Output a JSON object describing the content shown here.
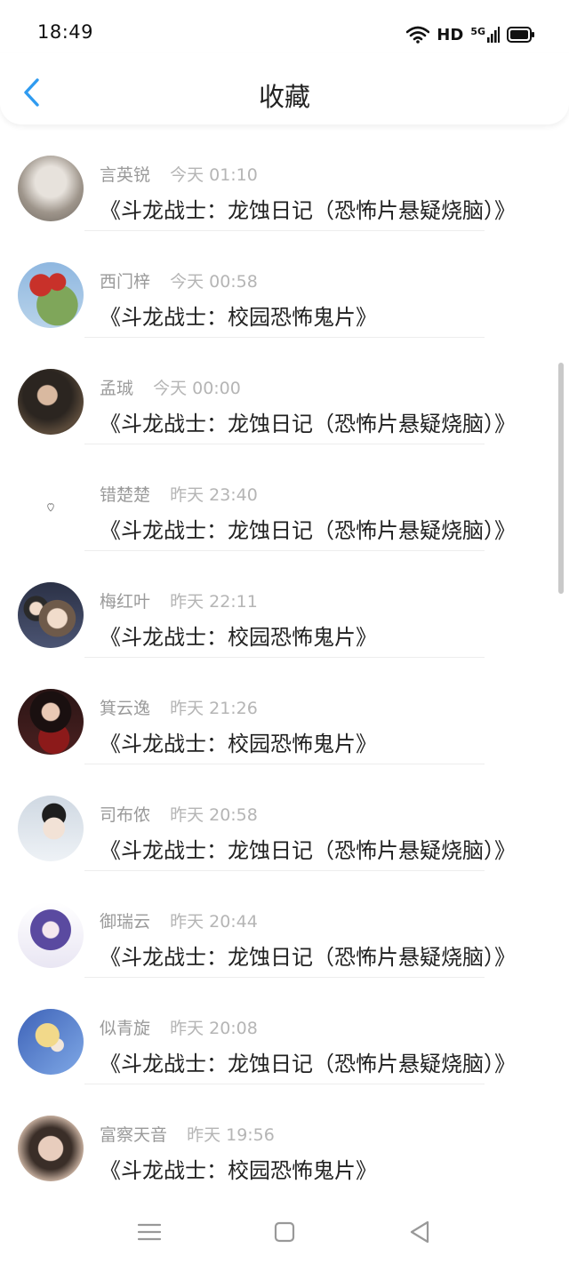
{
  "status": {
    "time": "18:49",
    "hd": "HD",
    "net": "5G"
  },
  "header": {
    "title": "收藏"
  },
  "items": [
    {
      "name": "言英锐",
      "time": "今天 01:10",
      "title": "《斗龙战士：龙蚀日记（恐怖片悬疑烧脑）》",
      "avatar_color": "#b9b2a8"
    },
    {
      "name": "西门梓",
      "time": "今天 00:58",
      "title": "《斗龙战士：校园恐怖鬼片》",
      "avatar_color": "#6d9f4a"
    },
    {
      "name": "孟珹",
      "time": "今天 00:00",
      "title": "《斗龙战士：龙蚀日记（恐怖片悬疑烧脑）》",
      "avatar_color": "#3d3530"
    },
    {
      "name": "错楚楚",
      "time": "昨天 23:40",
      "title": "《斗龙战士：龙蚀日记（恐怖片悬疑烧脑）》",
      "avatar_color": "#ffffff"
    },
    {
      "name": "梅红叶",
      "time": "昨天 22:11",
      "title": "《斗龙战士：校园恐怖鬼片》",
      "avatar_color": "#2f3548"
    },
    {
      "name": "箕云逸",
      "time": "昨天 21:26",
      "title": "《斗龙战士：校园恐怖鬼片》",
      "avatar_color": "#3a1a1a"
    },
    {
      "name": "司布侬",
      "time": "昨天 20:58",
      "title": "《斗龙战士：龙蚀日记（恐怖片悬疑烧脑）》",
      "avatar_color": "#d9dfe6"
    },
    {
      "name": "御瑞云",
      "time": "昨天 20:44",
      "title": "《斗龙战士：龙蚀日记（恐怖片悬疑烧脑）》",
      "avatar_color": "#6a5aa8"
    },
    {
      "name": "似青旋",
      "time": "昨天 20:08",
      "title": "《斗龙战士：龙蚀日记（恐怖片悬疑烧脑）》",
      "avatar_color": "#4e78c4"
    },
    {
      "name": "富察天音",
      "time": "昨天 19:56",
      "title": "《斗龙战士：校园恐怖鬼片》",
      "avatar_color": "#c9b4a4"
    }
  ],
  "colors": {
    "accent": "#2f9bf0",
    "name_text": "#9a9a9a",
    "time_text": "#b5b5b5",
    "title_text": "#222222"
  },
  "icons": {
    "back": "chevron-left-icon",
    "wifi": "wifi-icon",
    "signal": "signal-icon",
    "battery": "battery-icon",
    "menu": "menu-icon",
    "home": "home-icon",
    "back_nav": "back-triangle-icon"
  }
}
